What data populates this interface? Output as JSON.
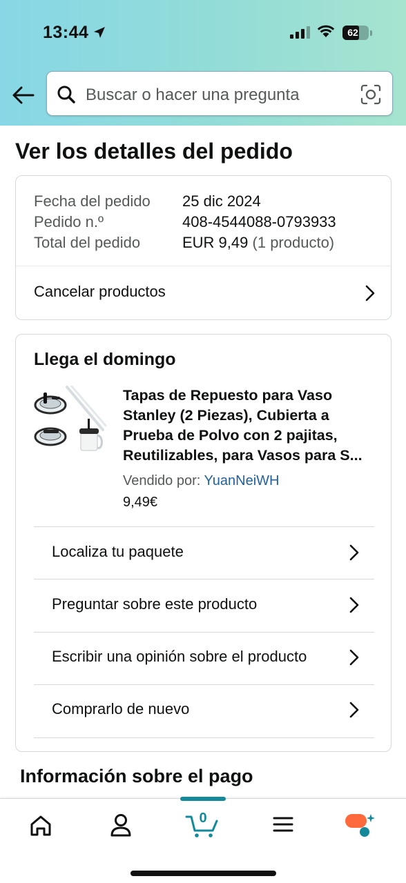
{
  "status_bar": {
    "time": "13:44",
    "battery": "62",
    "battery_level": 0.62
  },
  "search": {
    "placeholder": "Buscar o hacer una pregunta"
  },
  "page": {
    "title": "Ver los detalles del pedido"
  },
  "order_summary": {
    "date_label": "Fecha del pedido",
    "date_value": "25 dic 2024",
    "number_label": "Pedido n.º",
    "number_value": "408-4544088-0793933",
    "total_label": "Total del pedido",
    "total_value": "EUR 9,49",
    "total_count": "(1 producto)",
    "cancel_label": "Cancelar productos"
  },
  "shipment": {
    "delivery": "Llega el domingo",
    "product": {
      "title_lines": [
        "Tapas de Repuesto para Vaso",
        "Stanley (2 Piezas), Cubierta a",
        "Prueba de Polvo con 2 pajitas,",
        "Reutilizables, para Vasos para S..."
      ],
      "seller_label": "Vendido por:",
      "seller_name": "YuanNeiWH",
      "price": "9,49€"
    },
    "actions": [
      {
        "label": "Localiza tu paquete"
      },
      {
        "label": "Preguntar sobre este producto"
      },
      {
        "label": "Escribir una opinión sobre el producto"
      },
      {
        "label": "Comprarlo de nuevo"
      }
    ]
  },
  "payment": {
    "title": "Información sobre el pago"
  },
  "tabbar": {
    "cart_count": "0",
    "items": [
      "home-icon",
      "account-icon",
      "cart-icon",
      "menu-icon",
      "rufus-icon"
    ]
  },
  "colors": {
    "accent": "#13899a",
    "link": "#2162a1",
    "rufus": "#ff6a3d"
  }
}
